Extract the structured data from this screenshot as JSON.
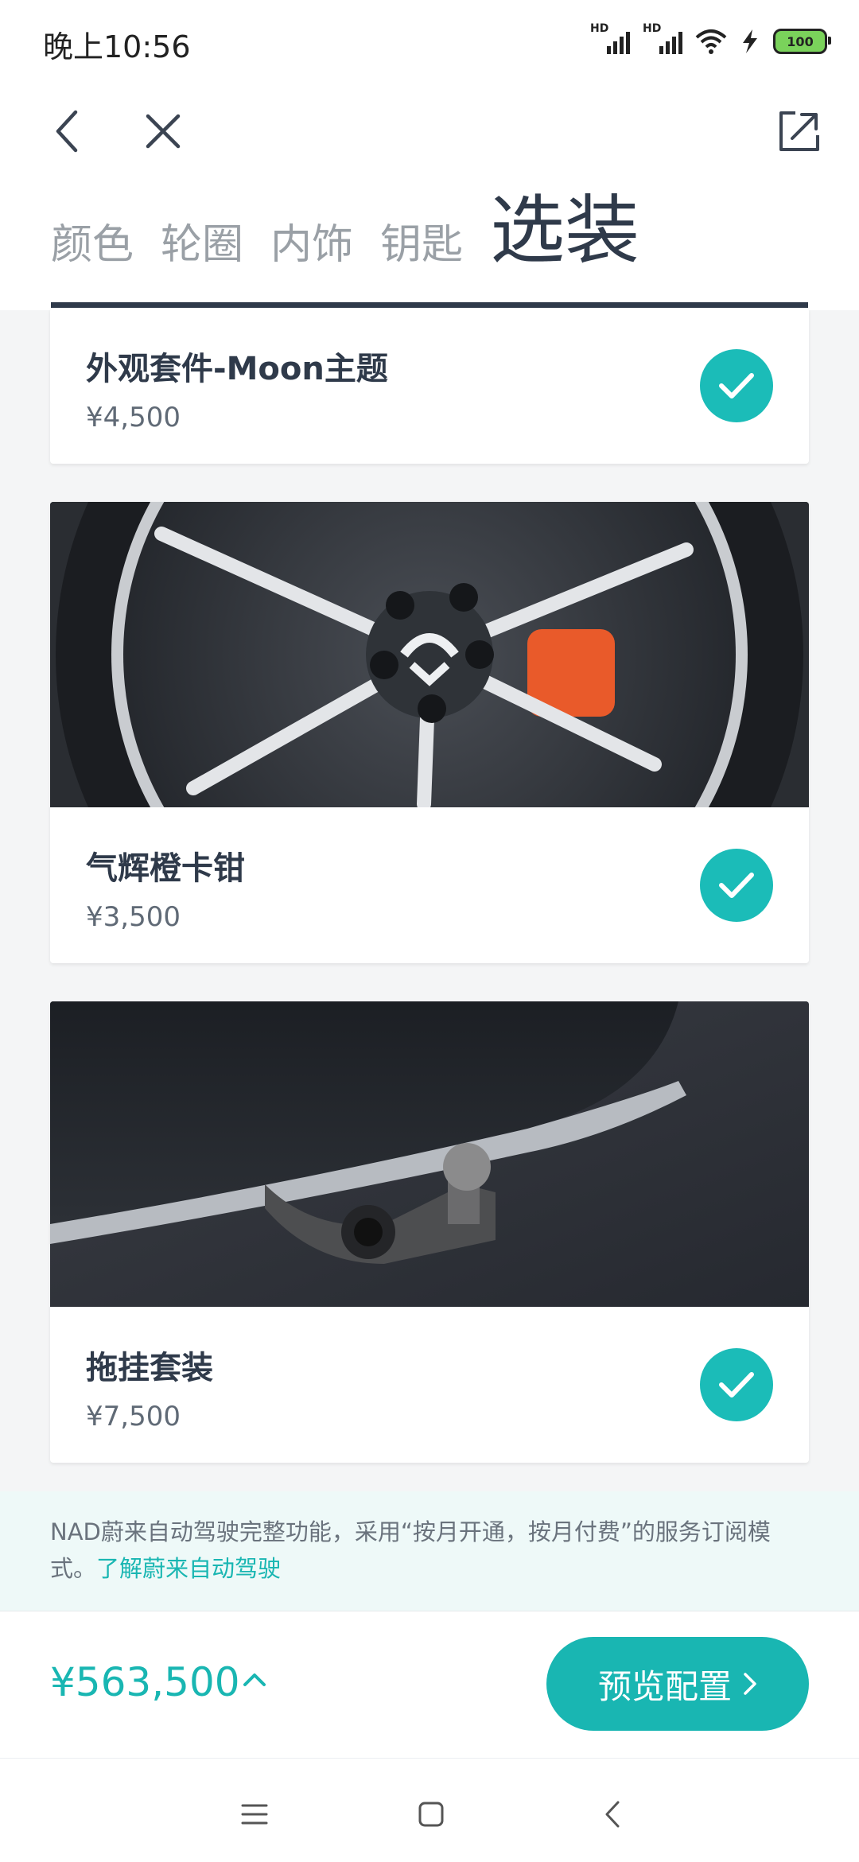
{
  "status_bar": {
    "time": "晚上10:56",
    "signal1_label": "HD",
    "signal2_label": "HD",
    "wifi_icon": "wifi-icon",
    "charging_icon": "bolt-icon",
    "battery": "100"
  },
  "nav": {
    "back_icon": "chevron-left-icon",
    "close_icon": "close-icon",
    "share_icon": "share-icon"
  },
  "tabs": [
    {
      "label": "颜色"
    },
    {
      "label": "轮圈"
    },
    {
      "label": "内饰"
    },
    {
      "label": "钥匙"
    },
    {
      "label": "选装",
      "active": true
    }
  ],
  "options": [
    {
      "title": "外观套件-Moon主题",
      "price": "¥4,500",
      "selected": true
    },
    {
      "title": "气辉橙卡钳",
      "price": "¥3,500",
      "selected": true,
      "image": "wheel-with-orange-caliper"
    },
    {
      "title": "拖挂套装",
      "price": "¥7,500",
      "selected": true,
      "image": "tow-hitch"
    }
  ],
  "info": {
    "text": "NAD蔚来自动驾驶完整功能，采用“按月开通，按月付费”的服务订阅模式。",
    "link": "了解蔚来自动驾驶"
  },
  "footer": {
    "total_price": "¥563,500",
    "preview_label": "预览配置"
  },
  "colors": {
    "accent": "#19b6b2",
    "text_primary": "#2f3a4a",
    "tab_inactive": "#9aa0a6"
  }
}
